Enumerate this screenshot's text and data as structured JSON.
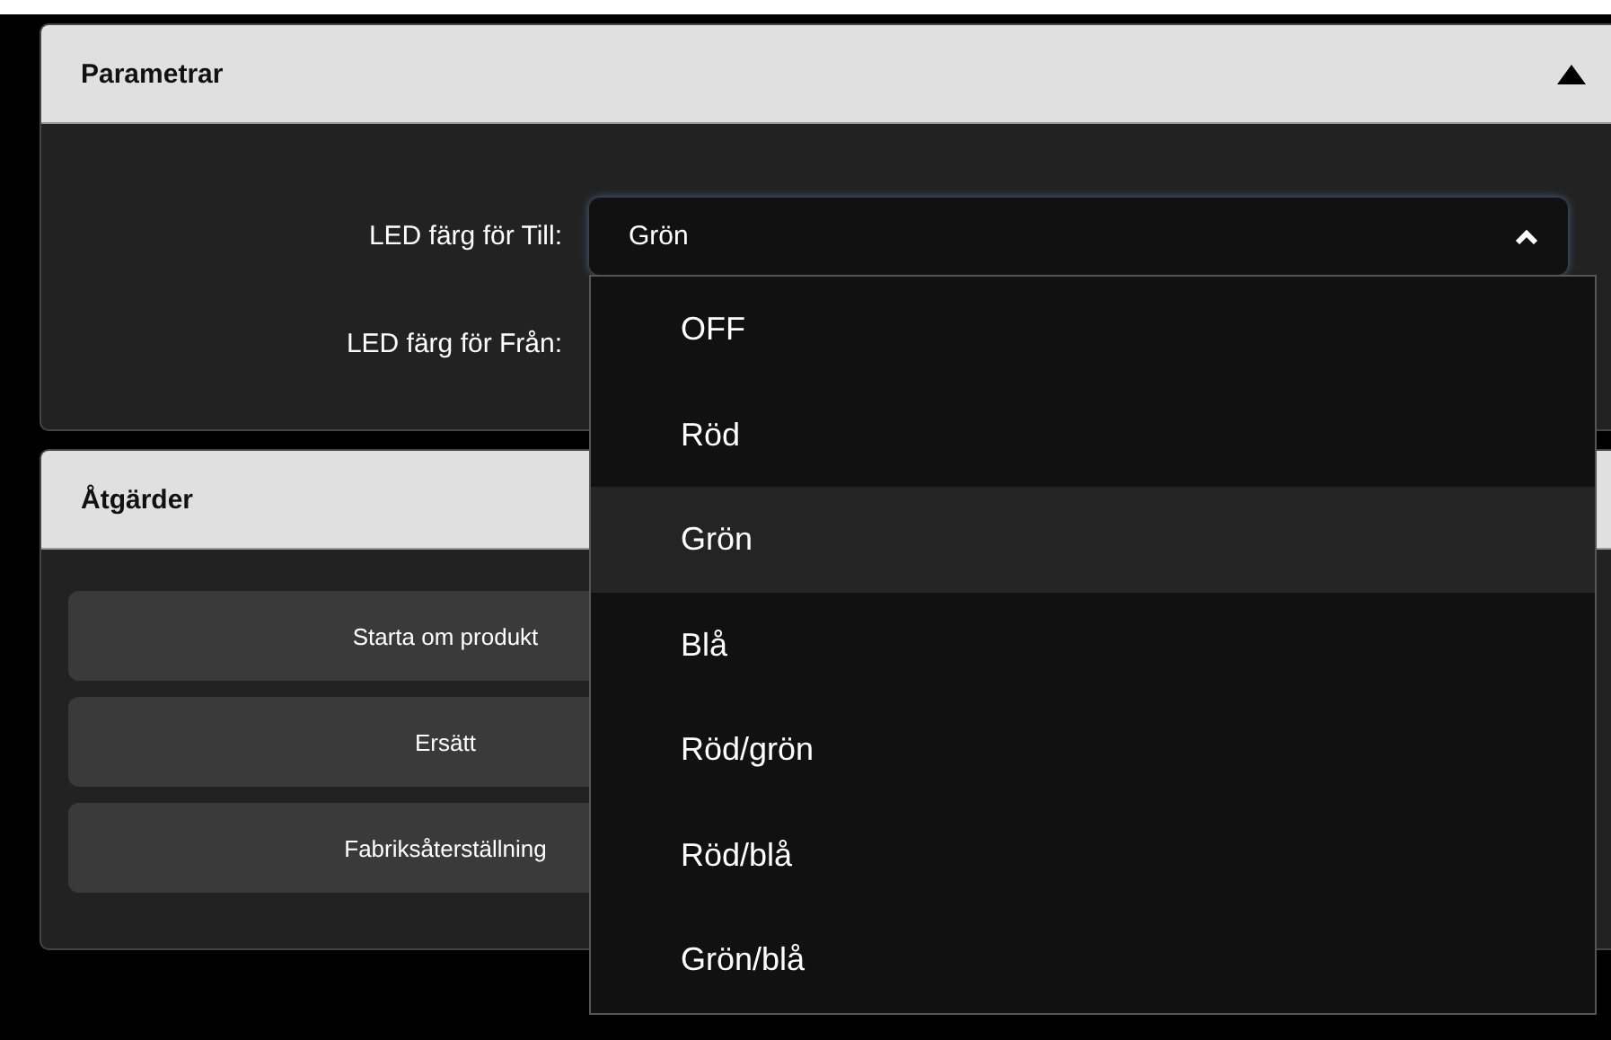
{
  "parameters": {
    "title": "Parametrar",
    "expanded": true,
    "fields": [
      {
        "label": "LED färg för Till:",
        "value": "Grön",
        "open": true
      },
      {
        "label": "LED färg för Från:"
      }
    ]
  },
  "dropdown": {
    "options": [
      {
        "label": "OFF",
        "selected": false
      },
      {
        "label": "Röd",
        "selected": false
      },
      {
        "label": "Grön",
        "selected": true
      },
      {
        "label": "Blå",
        "selected": false
      },
      {
        "label": "Röd/grön",
        "selected": false
      },
      {
        "label": "Röd/blå",
        "selected": false
      },
      {
        "label": "Grön/blå",
        "selected": false
      }
    ]
  },
  "actions": {
    "title": "Åtgärder",
    "buttons": [
      "Starta om produkt",
      "Ersätt",
      "Fabriksåterställning"
    ]
  }
}
